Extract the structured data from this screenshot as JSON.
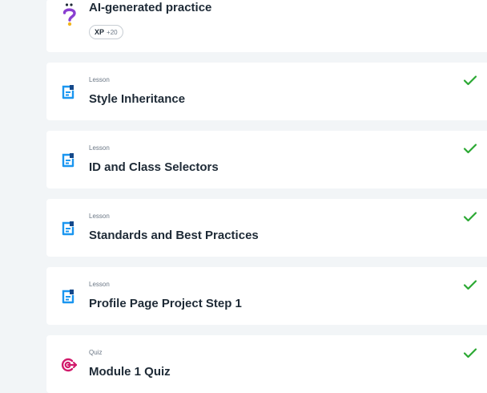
{
  "practice": {
    "title": "AI-generated practice",
    "xp_label": "XP",
    "xp_value": "+20",
    "icon": "question-icon"
  },
  "items": [
    {
      "type": "Lesson",
      "title": "Style Inheritance",
      "completed": true
    },
    {
      "type": "Lesson",
      "title": "ID and Class Selectors",
      "completed": true
    },
    {
      "type": "Lesson",
      "title": "Standards and Best Practices",
      "completed": true
    },
    {
      "type": "Lesson",
      "title": "Profile Page Project Step 1",
      "completed": true
    },
    {
      "type": "Quiz",
      "title": "Module 1 Quiz",
      "completed": true
    }
  ],
  "colors": {
    "page_bg": "#f2f5f7",
    "card_bg": "#ffffff",
    "lesson_icon": "#1a96f0",
    "lesson_icon_dark": "#14488a",
    "quiz_icon": "#d11a6b",
    "practice_icon": "#8a3fd1",
    "check": "#2aa832",
    "title_text": "#1e2a36"
  }
}
